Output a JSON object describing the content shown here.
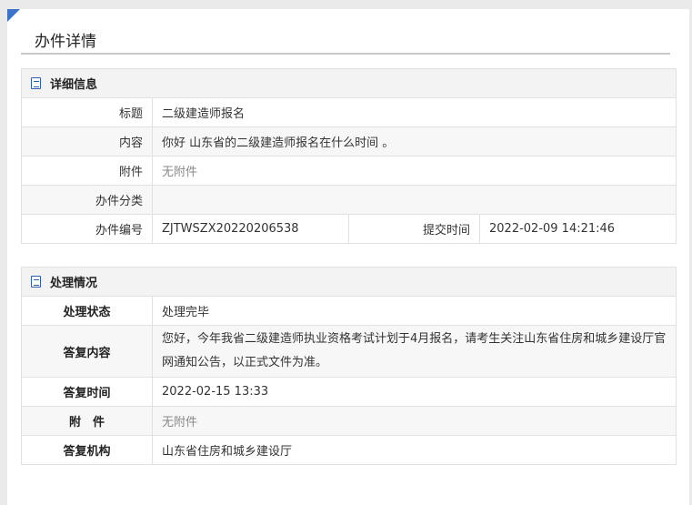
{
  "page": {
    "title": "办件详情"
  },
  "detail": {
    "heading": "详细信息",
    "rows": {
      "title": {
        "label": "标题",
        "value": "二级建造师报名"
      },
      "content": {
        "label": "内容",
        "value": "你好 山东省的二级建造师报名在什么时间 。"
      },
      "attachment": {
        "label": "附件",
        "value": "无附件"
      },
      "category": {
        "label": "办件分类",
        "value": ""
      },
      "number": {
        "label": "办件编号",
        "value": "ZJTWSZX20220206538"
      },
      "submit_time": {
        "label": "提交时间",
        "value": "2022-02-09 14:21:46"
      }
    }
  },
  "process": {
    "heading": "处理情况",
    "rows": {
      "status": {
        "label": "处理状态",
        "value": "处理完毕"
      },
      "reply": {
        "label": "答复内容",
        "value": "您好，今年我省二级建造师执业资格考试计划于4月报名，请考生关注山东省住房和城乡建设厅官网通知公告，以正式文件为准。"
      },
      "reply_time": {
        "label": "答复时间",
        "value": "2022-02-15 13:33"
      },
      "attachment": {
        "label": "附　件",
        "value": "无附件"
      },
      "org": {
        "label": "答复机构",
        "value": "山东省住房和城乡建设厅"
      }
    }
  },
  "colors": {
    "accent": "#3d72c9",
    "header_bg": "#f3f3f3",
    "muted": "#888888"
  }
}
